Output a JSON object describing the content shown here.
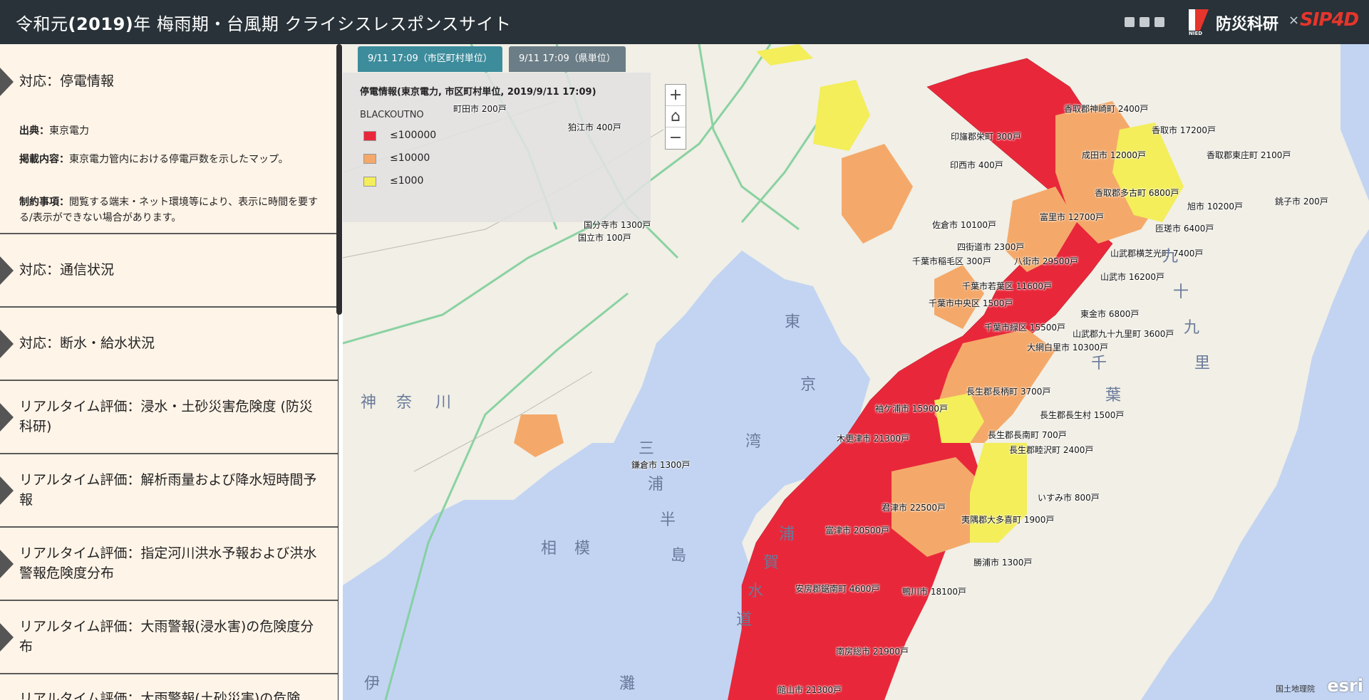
{
  "header": {
    "title_pre": "令和元",
    "title_year": "(2019)",
    "title_post": "年 梅雨期・台風期 クライシスレスポンスサイト",
    "share_icons": [
      "facebook-icon",
      "twitter-icon",
      "link-icon"
    ],
    "logo_sub": "NIED",
    "logo_org": "防災科研",
    "logo_times": "×",
    "logo_partner": "SIP4D"
  },
  "sidebar": {
    "sections": [
      {
        "label": "対応：停電情報",
        "expanded": true
      },
      {
        "label": "対応：通信状況"
      },
      {
        "label": "対応：断水・給水状況"
      },
      {
        "label": "リアルタイム評価：浸水・土砂災害危険度 (防災科研)"
      },
      {
        "label": "リアルタイム評価：解析雨量および降水短時間予報"
      },
      {
        "label": "リアルタイム評価：指定河川洪水予報および洪水警報危険度分布"
      },
      {
        "label": "リアルタイム評価：大雨警報(浸水害)の危険度分布"
      },
      {
        "label": "リアルタイム評価：大雨警報(土砂災害)の危険"
      }
    ],
    "info": {
      "source_key": "出典：",
      "source_val": "東京電力",
      "content_key": "掲載内容：",
      "content_val": "東京電力管内における停電戸数を示したマップ。",
      "note_key": "制約事項：",
      "note_val": "閲覧する端末・ネット環境等により、表示に時間を要する/表示ができない場合があります。"
    }
  },
  "map": {
    "tabs": [
      {
        "label": "9/11 17:09（市区町村単位）",
        "active": true
      },
      {
        "label": "9/11 17:09（県単位）",
        "active": false
      }
    ],
    "legend": {
      "title": "停電情報(東京電力, 市区町村単位, 2019/9/11 17:09)",
      "field": "BLACKOUTNO",
      "classes": [
        {
          "label": "≤100000",
          "color": "#e8283a"
        },
        {
          "label": "≤10000",
          "color": "#f4a96a"
        },
        {
          "label": "≤1000",
          "color": "#f3ee5a"
        }
      ]
    },
    "zoom": {
      "in": "+",
      "home": "⌂",
      "out": "−"
    },
    "labels": [
      "香取郡神崎町 2400戸",
      "香取市 17200戸",
      "印旛郡栄町 300戸",
      "成田市 12000戸",
      "香取郡東庄町 2100戸",
      "印西市 400戸",
      "香取郡多古町 6800戸",
      "旭市 10200戸",
      "銚子市 200戸",
      "富里市 12700戸",
      "佐倉市 10100戸",
      "匝瑳市 6400戸",
      "四街道市 2300戸",
      "山武郡横芝光町 7400戸",
      "千葉市稲毛区 300戸",
      "八街市 29500戸",
      "山武市 16200戸",
      "千葉市若葉区 11600戸",
      "千葉市中央区 1500戸",
      "東金市 6800戸",
      "千葉市緑区 15500戸",
      "山武郡九十九里町 3600戸",
      "大網白里市 10300戸",
      "長生郡長柄町 3700戸",
      "袖ケ浦市 15900戸",
      "長生郡長生村 1500戸",
      "木更津市 21300戸",
      "長生郡長南町 700戸",
      "長生郡睦沢町 2400戸",
      "鎌倉市 1300戸",
      "いすみ市 800戸",
      "君津市 22500戸",
      "夷隅郡大多喜町 1900戸",
      "富津市 20500戸",
      "勝浦市 1300戸",
      "安房郡鋸南町 4600戸",
      "鴨川市 18100戸",
      "南房総市 21900戸",
      "館山市 21300戸",
      "国分寺市 1300戸",
      "国立市 100戸",
      "町田市 200戸",
      "狛江市 400戸"
    ],
    "place_names": [
      "東",
      "京",
      "湾",
      "浦",
      "賀",
      "水",
      "道",
      "相",
      "模",
      "灘",
      "神",
      "奈",
      "川",
      "千",
      "葉",
      "三",
      "浦",
      "半",
      "島",
      "九",
      "十",
      "九",
      "里",
      "伊"
    ],
    "attribution": "国土地理院",
    "esri": "esri"
  }
}
